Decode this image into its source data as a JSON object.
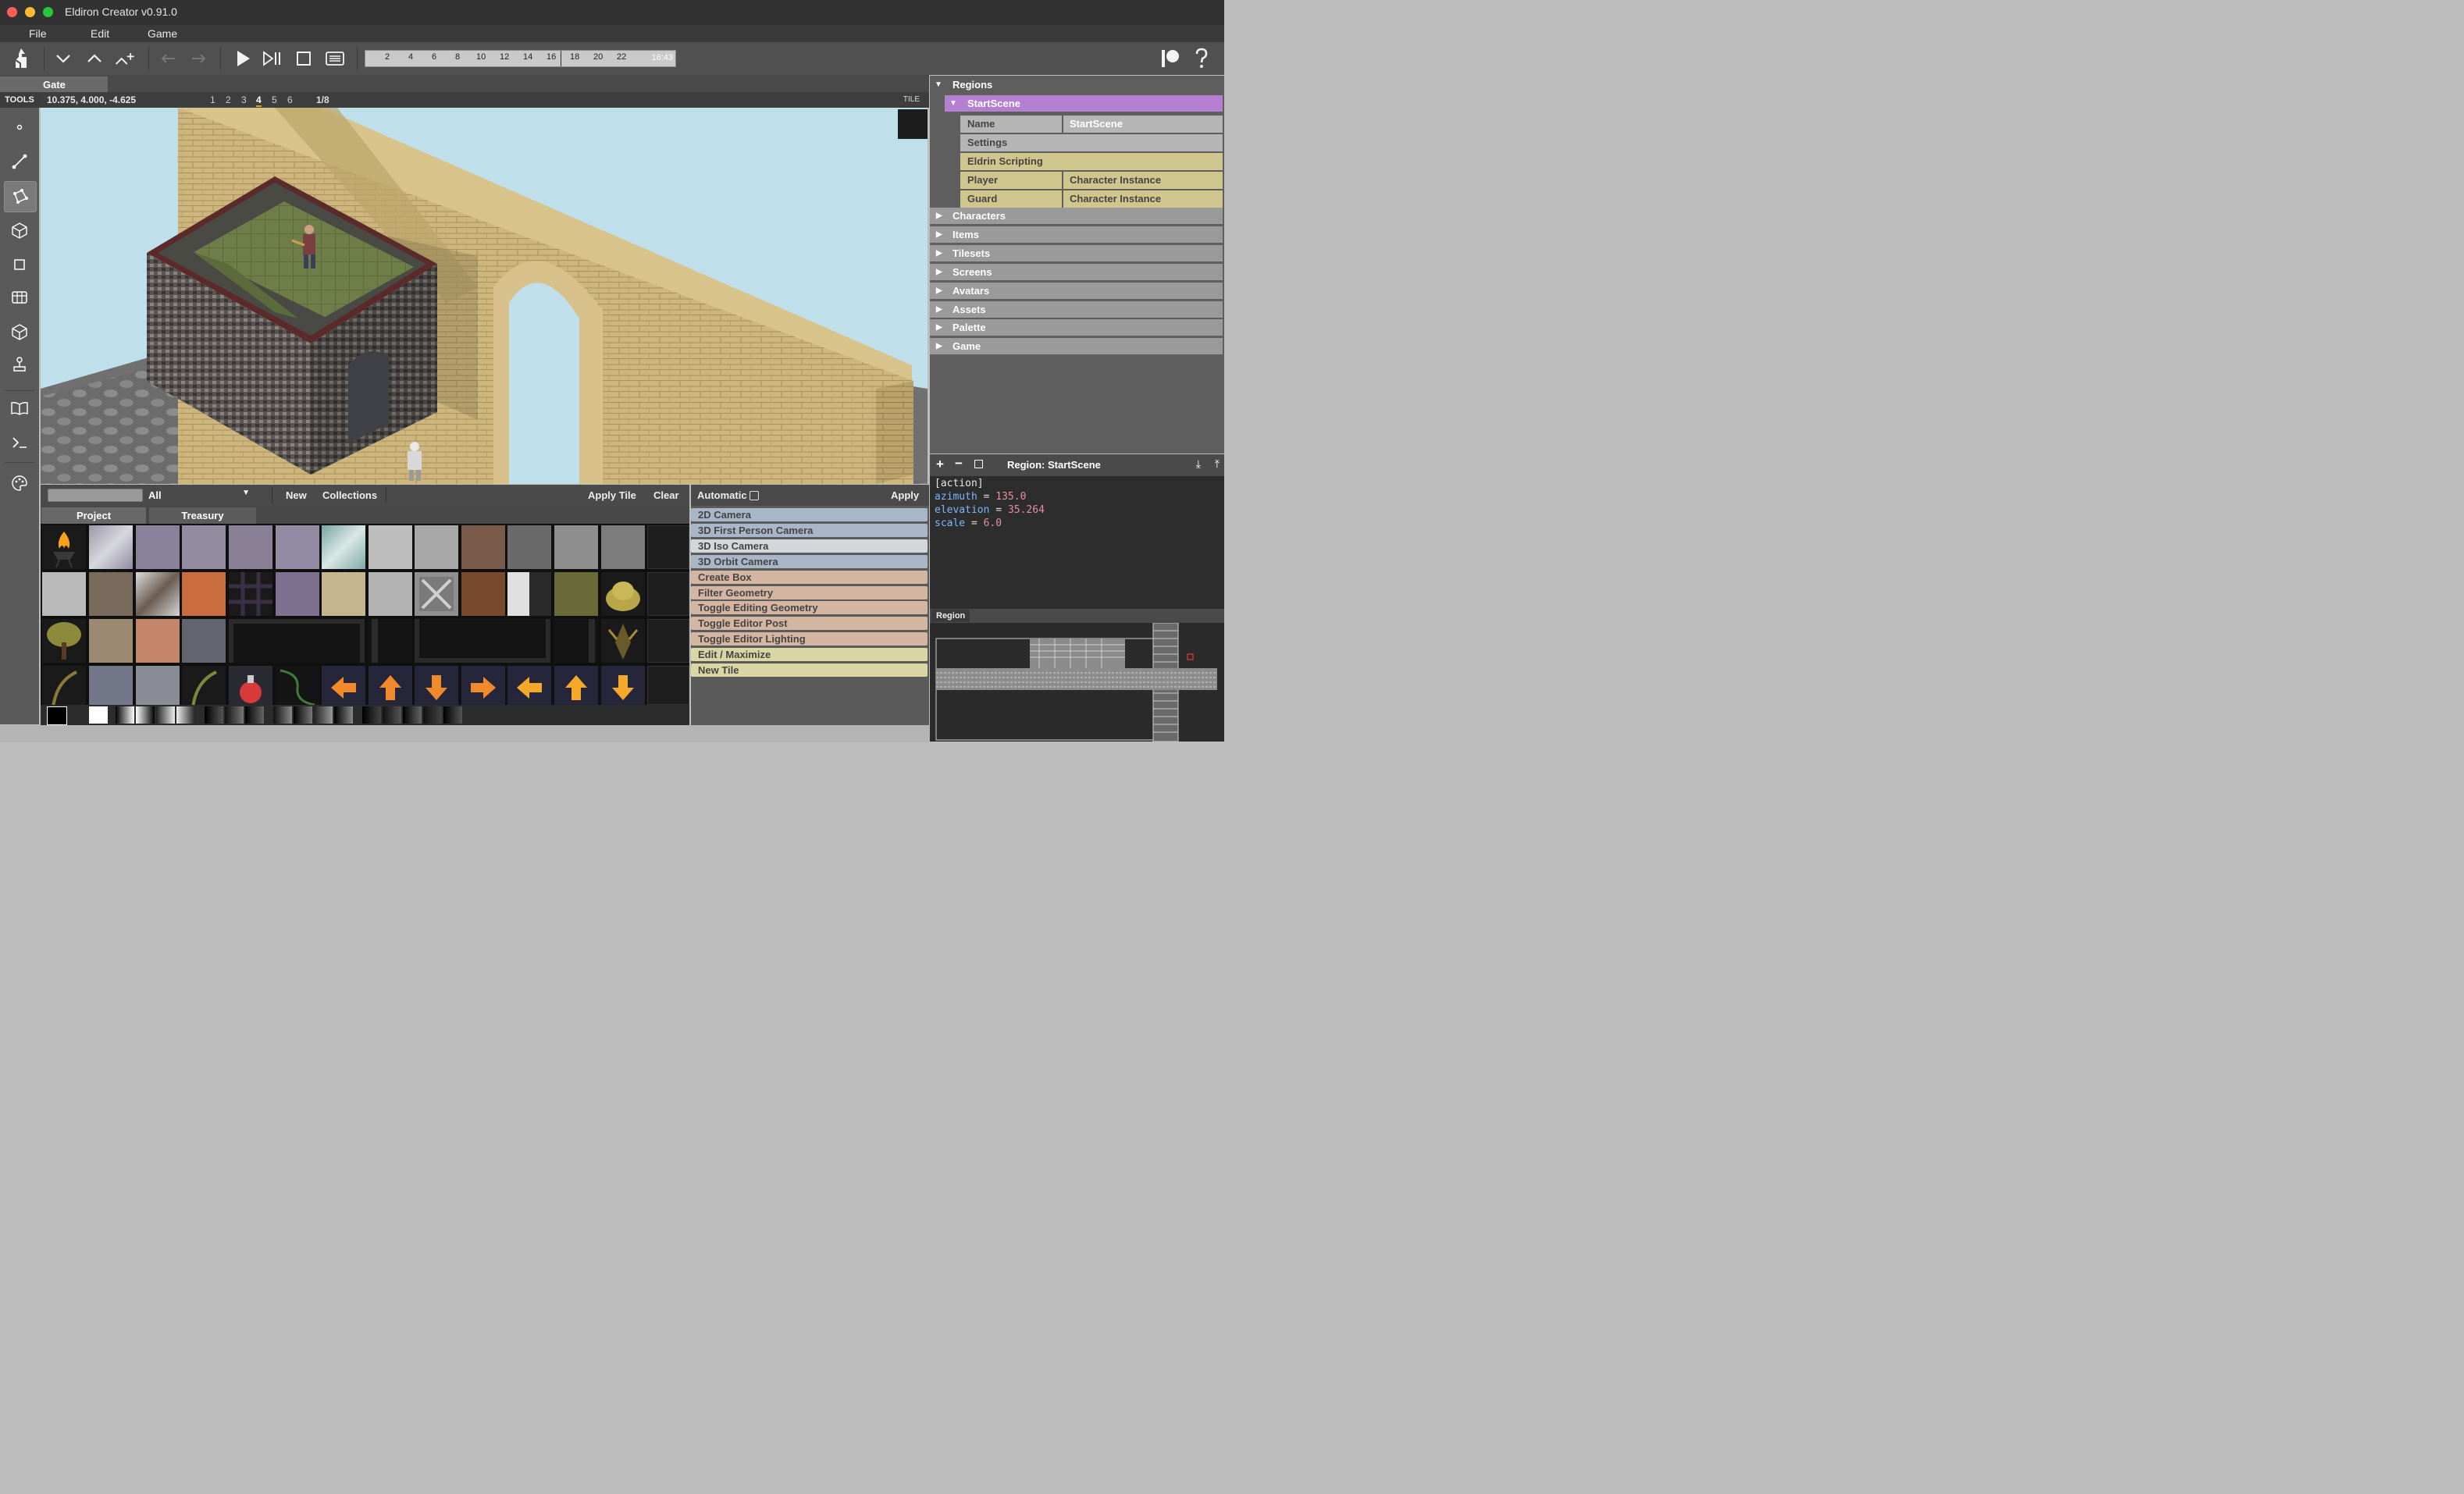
{
  "window": {
    "title": "Eldiron Creator v0.91.0",
    "controls": {
      "close_color": "#ff5f57",
      "minimize_color": "#febc2e",
      "zoom_color": "#28c840"
    }
  },
  "menu": {
    "items": [
      "File",
      "Edit",
      "Game"
    ]
  },
  "toolbar": {
    "icons": [
      "logo-icon",
      "move-down-icon",
      "move-up-icon",
      "add-above-icon",
      "undo-icon",
      "redo-icon",
      "play-icon",
      "step-icon",
      "stop-icon",
      "console-icon",
      "patreon-icon",
      "help-icon"
    ],
    "timeline": {
      "ticks": [
        "2",
        "4",
        "6",
        "8",
        "10",
        "12",
        "14",
        "16",
        "18",
        "20",
        "22"
      ],
      "current_time": "16:43"
    }
  },
  "doc_tab": {
    "label": "Gate"
  },
  "tools": {
    "label": "TOOLS",
    "items": [
      "vertex-tool-icon",
      "linedef-tool-icon",
      "sector-tool-icon",
      "cube-tool-icon",
      "rect-tool-icon",
      "tileset-tool-icon",
      "entity-tool-icon",
      "game-tool-icon",
      "info-tool-icon",
      "code-tool-icon",
      "palette-tool-icon"
    ]
  },
  "viewport": {
    "coords": "10.375, 4.000, -4.625",
    "layers": [
      "1",
      "2",
      "3",
      "4",
      "5",
      "6"
    ],
    "active_layer": "4",
    "zoom_level": "1/8",
    "mode_label": "TILE"
  },
  "tile_picker": {
    "search_value": "",
    "filter_value": "All",
    "buttons": {
      "new": "New",
      "collections": "Collections",
      "apply_tile": "Apply Tile",
      "clear": "Clear"
    },
    "tabs": [
      "Project",
      "Treasury"
    ]
  },
  "commands": {
    "automatic_label": "Automatic",
    "automatic_checked": false,
    "apply_label": "Apply",
    "items": [
      {
        "label": "2D Camera",
        "color": "#a8b6c8"
      },
      {
        "label": "3D First Person Camera",
        "color": "#a8b6c8"
      },
      {
        "label": "3D Iso Camera",
        "color": "#d3d7dc"
      },
      {
        "label": "3D Orbit Camera",
        "color": "#a8b6c8"
      },
      {
        "label": "Create Box",
        "color": "#d4b5a2"
      },
      {
        "label": "Filter Geometry",
        "color": "#d4b5a2"
      },
      {
        "label": "Toggle Editing Geometry",
        "color": "#d4b5a2"
      },
      {
        "label": "Toggle Editor Post",
        "color": "#d4b5a2"
      },
      {
        "label": "Toggle Editor Lighting",
        "color": "#d4b5a2"
      },
      {
        "label": "Edit / Maximize",
        "color": "#d9d6a4"
      },
      {
        "label": "New Tile",
        "color": "#d9d6a4"
      }
    ]
  },
  "project_tree": {
    "regions": {
      "label": "Regions",
      "selected": {
        "label": "StartScene",
        "color": "#b47fd0",
        "props": [
          {
            "label": "Name",
            "value": "StartScene",
            "color": "#b5b5b5"
          },
          {
            "label": "Settings",
            "value": "",
            "color": "#b5b5b5"
          },
          {
            "label": "Eldrin Scripting",
            "value": "",
            "color": "#cfc68d"
          },
          {
            "label": "Player",
            "value": "Character Instance",
            "color": "#cfc68d"
          },
          {
            "label": "Guard",
            "value": "Character Instance",
            "color": "#cfc68d"
          }
        ]
      }
    },
    "sections": [
      "Characters",
      "Items",
      "Tilesets",
      "Screens",
      "Avatars",
      "Assets",
      "Palette",
      "Game"
    ]
  },
  "region_panel": {
    "title": "Region: StartScene",
    "script": [
      {
        "type": "section",
        "text": "[action]"
      },
      {
        "type": "kv",
        "key": "azimuth",
        "value": "135.0"
      },
      {
        "type": "kv",
        "key": "elevation",
        "value": "35.264"
      },
      {
        "type": "kv",
        "key": "scale",
        "value": "6.0"
      }
    ],
    "minimap_label": "Region"
  }
}
